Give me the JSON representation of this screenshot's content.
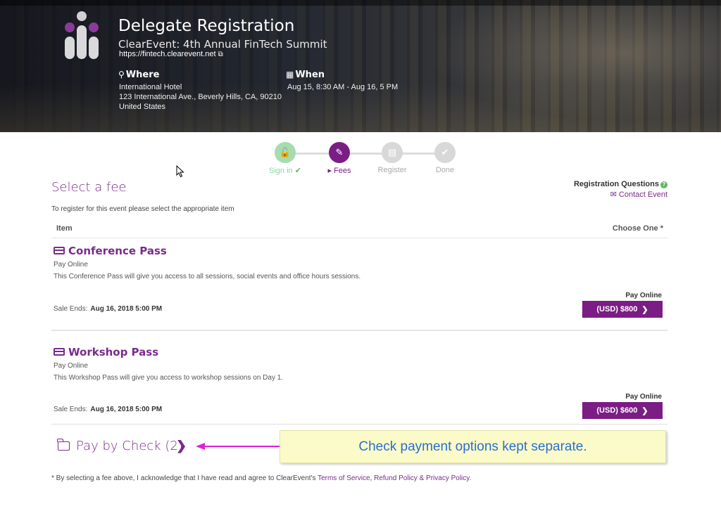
{
  "header": {
    "title": "Delegate Registration",
    "subtitle": "ClearEvent: 4th Annual FinTech Summit",
    "url": "https://fintech.clearevent.net",
    "where_label": "Where",
    "where_lines": [
      "International Hotel",
      "123 International Ave., Beverly Hills, CA, 90210",
      "United States"
    ],
    "when_label": "When",
    "when_text": "Aug 15, 8:30 AM - Aug 16, 5 PM",
    "logo_colors": [
      "#8a3a98",
      "#cfcfd4"
    ]
  },
  "stepper": {
    "steps": [
      {
        "label": "Sign in",
        "status": "done",
        "icon": "unlock-icon",
        "suffix": "✔"
      },
      {
        "label": "Fees",
        "status": "active",
        "icon": "ticket-icon",
        "prefix": "▸"
      },
      {
        "label": "Register",
        "status": "pending",
        "icon": "form-icon"
      },
      {
        "label": "Done",
        "status": "pending",
        "icon": "check-icon"
      }
    ],
    "colors": {
      "done": "#a6dcae",
      "active": "#7b1d84",
      "pending": "#d8d8d8"
    }
  },
  "main": {
    "heading": "Select a fee",
    "registration_questions": "Registration Questions",
    "contact_event": "Contact Event",
    "intro": "To register for this event please select the appropriate item",
    "table_headers": {
      "item": "Item",
      "choose": "Choose One *"
    },
    "fees": [
      {
        "title": "Conference Pass",
        "pay_method": "Pay Online",
        "description": "This Conference Pass will give you access to all sessions, social events and office hours sessions.",
        "sale_ends_label": "Sale Ends:",
        "sale_ends": "Aug 16, 2018 5:00 PM",
        "button_heading": "Pay Online",
        "button_label": "(USD) $800"
      },
      {
        "title": "Workshop Pass",
        "pay_method": "Pay Online",
        "description": "This Workshop Pass will give you access to workshop sessions on Day 1.",
        "sale_ends_label": "Sale Ends:",
        "sale_ends": "Aug 16, 2018 5:00 PM",
        "button_heading": "Pay Online",
        "button_label": "(USD) $600"
      }
    ],
    "pay_by_check": "Pay by Check (2)",
    "callout": "Check payment options kept separate.",
    "footnote": {
      "prefix": "* By selecting a fee above, I acknowledge that I have read and agree to ClearEvent's ",
      "terms": "Terms of Service",
      "sep1": ", ",
      "refund": "Refund Policy",
      "sep2": " & ",
      "privacy": "Privacy Policy",
      "end": "."
    },
    "accent_color": "#7b1d84",
    "callout_text_color": "#2a6fd1",
    "arrow_color": "#e020d8"
  }
}
